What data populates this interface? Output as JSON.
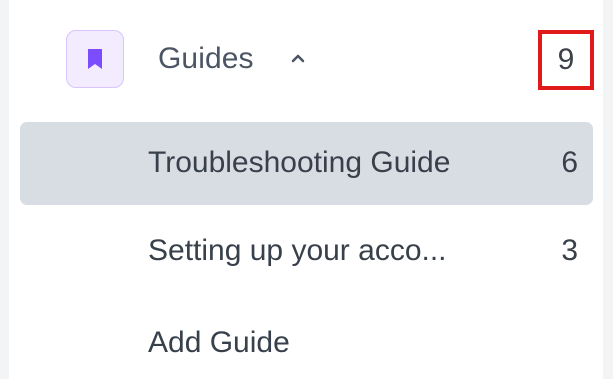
{
  "section": {
    "icon": "bookmark-icon",
    "label": "Guides",
    "chevron_icon": "chevron-up-icon",
    "count": "9",
    "accent_color": "#7c4dff",
    "highlight_color": "#e01919"
  },
  "items": [
    {
      "label": "Troubleshooting Guide",
      "count": "6",
      "selected": true
    },
    {
      "label": "Setting up your acco...",
      "count": "3",
      "selected": false
    }
  ],
  "add_label": "Add Guide"
}
